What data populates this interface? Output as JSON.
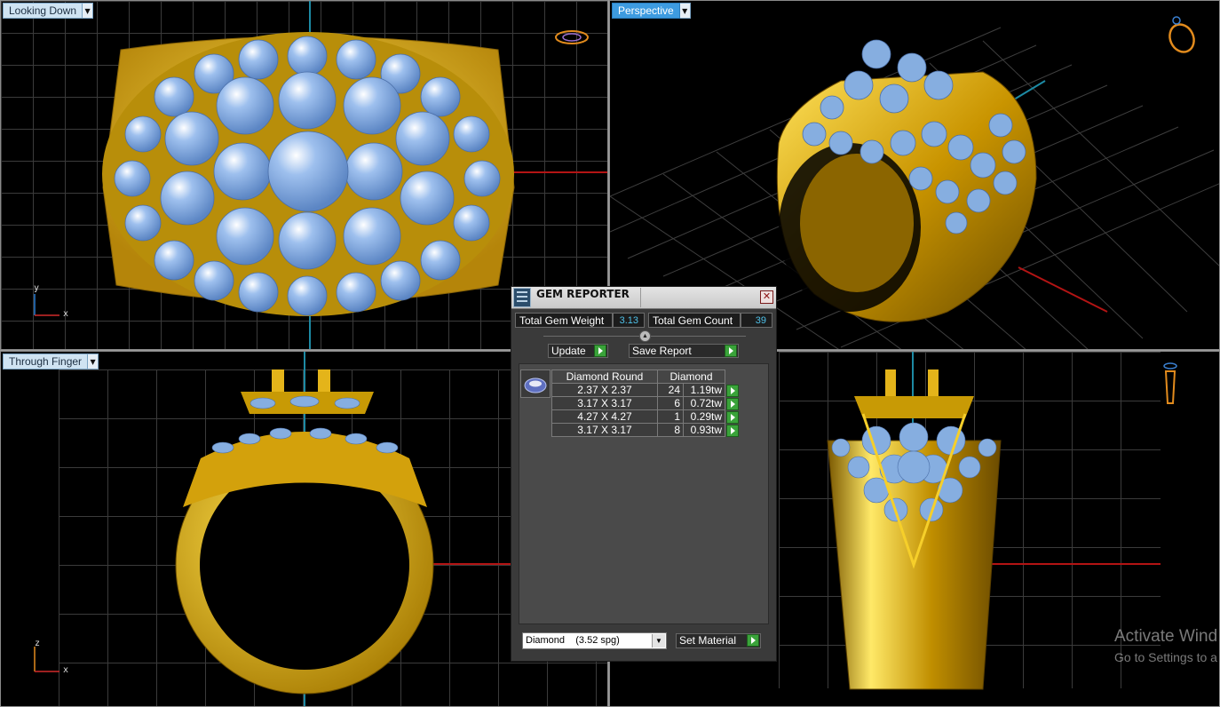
{
  "viewports": {
    "top_left": {
      "label": "Looking Down"
    },
    "top_right": {
      "label": "Perspective"
    },
    "bottom_left": {
      "label": "Through Finger"
    }
  },
  "axes": {
    "x": "x",
    "y": "y",
    "z": "z"
  },
  "dialog": {
    "title": "GEM REPORTER",
    "total_weight_label": "Total Gem Weight",
    "total_weight_value": "3.13",
    "total_count_label": "Total Gem Count",
    "total_count_value": "39",
    "update_label": "Update",
    "save_report_label": "Save Report",
    "table_headers": [
      "Diamond Round",
      "Diamond"
    ],
    "rows": [
      {
        "size": "2.37 X 2.37",
        "count": "24",
        "weight": "1.19tw"
      },
      {
        "size": "3.17 X 3.17",
        "count": "6",
        "weight": "0.72tw"
      },
      {
        "size": "4.27 X 4.27",
        "count": "1",
        "weight": "0.29tw"
      },
      {
        "size": "3.17 X 3.17",
        "count": "8",
        "weight": "0.93tw"
      }
    ],
    "material_select": "Diamond    (3.52 spg)",
    "set_material_label": "Set Material"
  },
  "watermark": {
    "line1": "Activate Wind",
    "line2": "Go to Settings to a"
  },
  "colors": {
    "gold": "#d6a40c",
    "gem": "#86aee0",
    "grid": "#3b3b3b",
    "active_label": "#3d9be0",
    "value_text": "#4fc1e9"
  }
}
